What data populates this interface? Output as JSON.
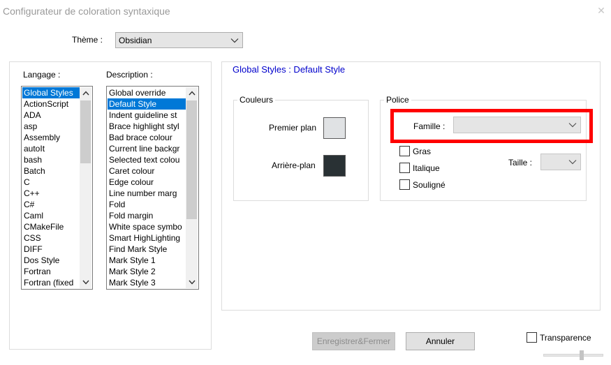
{
  "window": {
    "title": "Configurateur de coloration syntaxique",
    "close_icon": "close-icon"
  },
  "theme": {
    "label": "Thème :",
    "selected": "Obsidian"
  },
  "language_list": {
    "label": "Langage :",
    "items": [
      "Global Styles",
      "ActionScript",
      "ADA",
      "asp",
      "Assembly",
      "autoIt",
      "bash",
      "Batch",
      "C",
      "C++",
      "C#",
      "Caml",
      "CMakeFile",
      "CSS",
      "DIFF",
      "Dos Style",
      "Fortran",
      "Fortran (fixed"
    ],
    "selected_index": 0
  },
  "description_list": {
    "label": "Description :",
    "items": [
      "Global override",
      "Default Style",
      "Indent guideline st",
      "Brace highlight styl",
      "Bad brace colour",
      "Current line backgr",
      "Selected text colou",
      "Caret colour",
      "Edge colour",
      "Line number marg",
      "Fold",
      "Fold margin",
      "White space symbo",
      "Smart HighLighting",
      "Find Mark Style",
      "Mark Style 1",
      "Mark Style 2",
      "Mark Style 3"
    ],
    "selected_index": 1
  },
  "style_panel": {
    "heading": "Global Styles : Default Style",
    "colors_group": {
      "caption": "Couleurs",
      "foreground_label": "Premier plan",
      "background_label": "Arrière-plan",
      "foreground_color": "#e0e2e4",
      "background_color": "#293134"
    },
    "font_group": {
      "caption": "Police",
      "family_label": "Famille :",
      "family_value": "",
      "bold_label": "Gras",
      "italic_label": "Italique",
      "underline_label": "Souligné",
      "size_label": "Taille :",
      "size_value": ""
    }
  },
  "buttons": {
    "save_close": "Enregistrer&Fermer",
    "cancel": "Annuler"
  },
  "transparency": {
    "label": "Transparence"
  },
  "colors": {
    "highlight": "#ff0000",
    "selection": "#0078d7",
    "heading_blue": "#0000cc"
  }
}
